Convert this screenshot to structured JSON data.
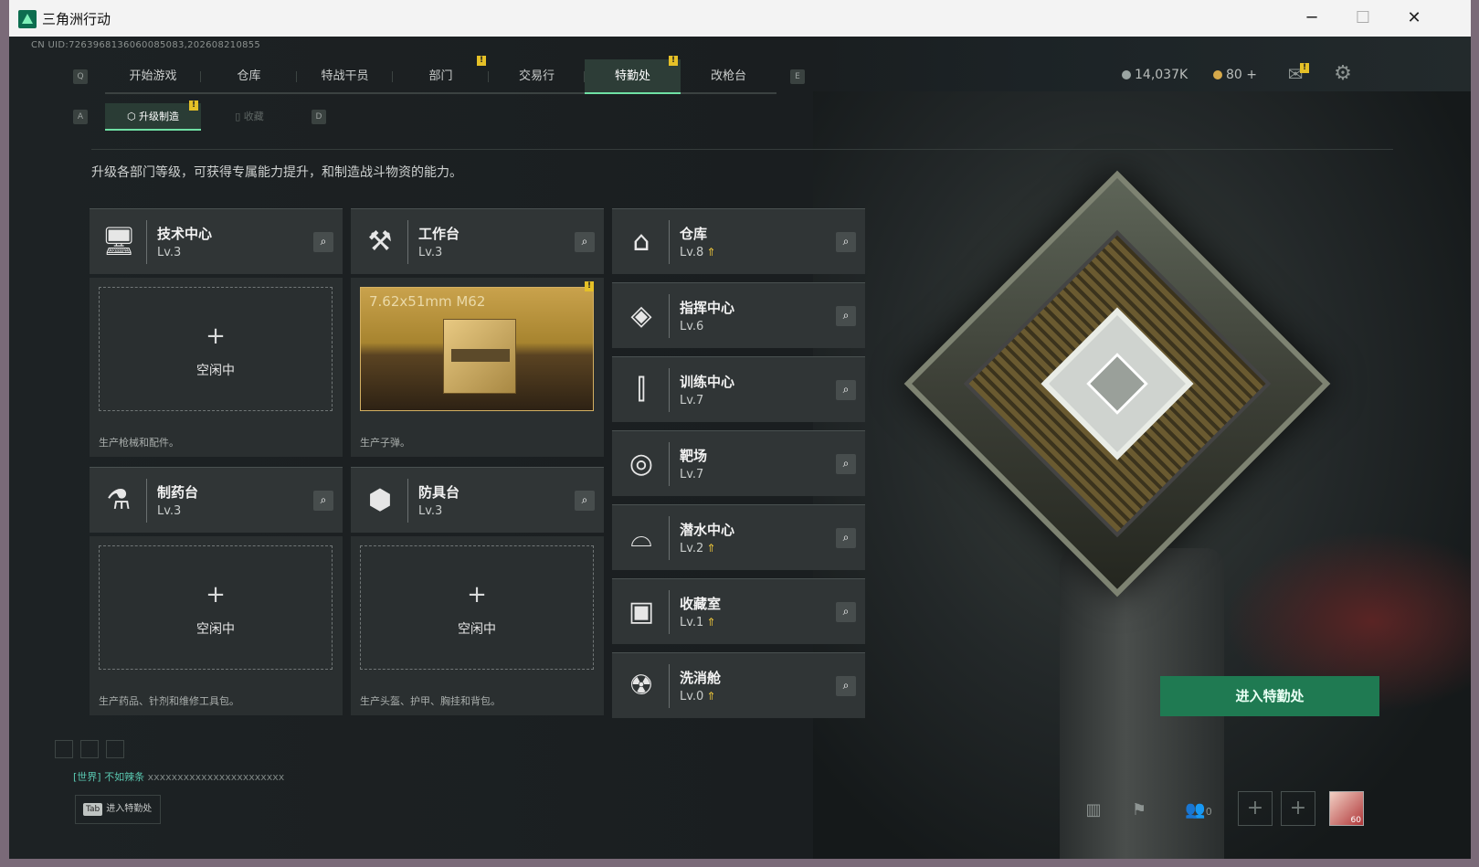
{
  "window": {
    "title": "三角洲行动",
    "minimize": "─",
    "maximize": "☐",
    "close": "✕"
  },
  "uid": "CN UID:7263968136060085083,202608210855",
  "keys": {
    "left": "Q",
    "right": "E",
    "sub_left": "A",
    "sub_right": "D"
  },
  "tabs": [
    {
      "label": "开始游戏"
    },
    {
      "label": "仓库"
    },
    {
      "label": "特战干员"
    },
    {
      "label": "部门"
    },
    {
      "label": "交易行"
    },
    {
      "label": "特勤处"
    },
    {
      "label": "改枪台"
    }
  ],
  "subtabs": {
    "upgrade": "升级制造",
    "collect": "收藏"
  },
  "currency": {
    "coins": "14,037K",
    "tickets": "80",
    "plus": "+"
  },
  "description": "升级各部门等级，可获得专属能力提升，和制造战斗物资的能力。",
  "left_departments": [
    {
      "name": "技术中心",
      "level": "Lv.3",
      "slot_state": "空闲中",
      "caption": "生产枪械和配件。"
    },
    {
      "name": "工作台",
      "level": "Lv.3",
      "product": "7.62x51mm M62",
      "caption": "生产子弹。"
    },
    {
      "name": "制药台",
      "level": "Lv.3",
      "slot_state": "空闲中",
      "caption": "生产药品、针剂和维修工具包。"
    },
    {
      "name": "防具台",
      "level": "Lv.3",
      "slot_state": "空闲中",
      "caption": "生产头盔、护甲、胸挂和背包。"
    }
  ],
  "right_departments": [
    {
      "name": "仓库",
      "level": "Lv.8",
      "upgradable": true
    },
    {
      "name": "指挥中心",
      "level": "Lv.6",
      "upgradable": false
    },
    {
      "name": "训练中心",
      "level": "Lv.7",
      "upgradable": false
    },
    {
      "name": "靶场",
      "level": "Lv.7",
      "upgradable": false
    },
    {
      "name": "潜水中心",
      "level": "Lv.2",
      "upgradable": true
    },
    {
      "name": "收藏室",
      "level": "Lv.1",
      "upgradable": true
    },
    {
      "name": "洗消舱",
      "level": "Lv.0",
      "upgradable": true
    }
  ],
  "cta": "进入特勤处",
  "chat": {
    "channel": "[世界]",
    "user": "不如辣条",
    "message": "xxxxxxxxxxxxxxxxxxxxxxx"
  },
  "tab_hint": {
    "key": "Tab",
    "label": "进入特勤处"
  },
  "friends_count": "0",
  "avatar_level": "60"
}
